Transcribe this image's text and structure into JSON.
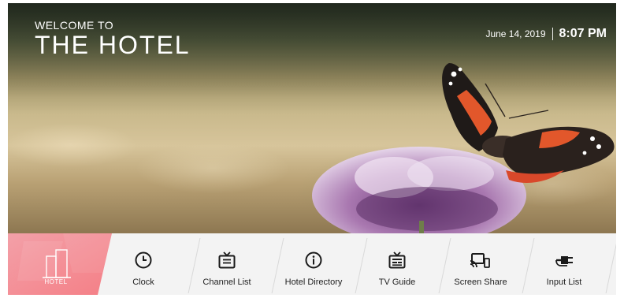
{
  "welcome": {
    "line1": "WELCOME TO",
    "line2": "THE HOTEL"
  },
  "datetime": {
    "date": "June 14, 2019",
    "time": "8:07 PM"
  },
  "home_tile": {
    "label": "HOTEL",
    "icon": "hotel-building-icon",
    "colors": [
      "#f47f86",
      "#f3a0a8"
    ]
  },
  "menu": {
    "items": [
      {
        "label": "Clock",
        "icon": "clock-icon"
      },
      {
        "label": "Channel List",
        "icon": "tv-list-icon"
      },
      {
        "label": "Hotel Directory",
        "icon": "info-icon"
      },
      {
        "label": "TV Guide",
        "icon": "tv-guide-icon"
      },
      {
        "label": "Screen Share",
        "icon": "screen-share-icon"
      },
      {
        "label": "Input List",
        "icon": "input-plug-icon"
      }
    ]
  }
}
